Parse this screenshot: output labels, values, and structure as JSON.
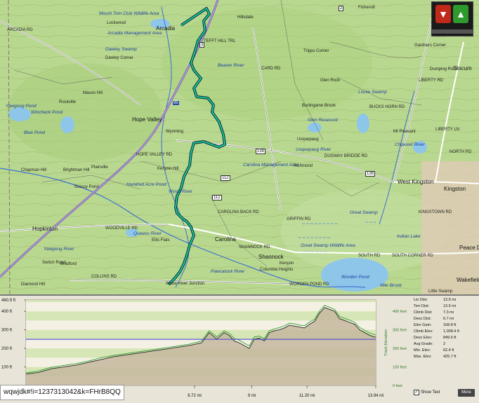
{
  "map": {
    "place_labels": [
      "Arcadia",
      "Hope Valley",
      "Rockville",
      "Hopkinton",
      "Carolina",
      "Shannock",
      "Kenyon",
      "Wood River Junction",
      "Ellis Flats",
      "Slocum",
      "West Kingston",
      "Kingston",
      "Usquepaug",
      "Richmond",
      "Tripps Corner",
      "Gardners Corner",
      "Dawley Corner",
      "Dumping Rock",
      "Burlingame Brook",
      "Columbia Heights",
      "Peace Dale",
      "Wakefield",
      "Switch Road",
      "Hillsdale",
      "Fishervill",
      "Mt Pleasant",
      "Glen Rock",
      "Diamond Hill",
      "Mason Hill",
      "Grassy Pond",
      "Wyoming",
      "Bradford",
      "Chapman Hill",
      "Brightman Hill",
      "Plainville",
      "Lockwood",
      "Kenyon Hill",
      "Little Swamp"
    ],
    "water_labels": [
      "Mount Tom Club Wildlife Area",
      "Arcadia Management Area",
      "Dawley Swamp",
      "Yawgoog Pond",
      "Wincheck Pond",
      "Blue Pond",
      "Locke Swamp",
      "Glen Reservoir",
      "Great Swamp",
      "Great Swamp Wildlife Area",
      "Worden Pond",
      "Wood River",
      "Beaver River",
      "Chipuxet River",
      "Queens River",
      "Hundred Acre Pond",
      "Yawgoog River",
      "Carolina Management Area",
      "Mile Brook",
      "Indian Lake",
      "Usquepaug River",
      "Pawcatuck River"
    ],
    "road_labels": [
      "TEFFT HILL TRL",
      "CARD RD",
      "LIBERTY RD",
      "LIBERTY LN",
      "WOODVILLE RD",
      "WORDEN POND RD",
      "COLLINS RD",
      "SOUTH CORNER RD",
      "KINGSTOWN RD",
      "NORTH RD",
      "DUGWAY BRIDGE RD",
      "HOPE VALLEY RD",
      "BUCKS HORN RD",
      "SHANNOCK RD",
      "ARCADIA RD",
      "GRIFFIN RD",
      "SOUTH RD",
      "CAROLINA BACK RD"
    ],
    "route_shields": [
      "3",
      "95",
      "112",
      "138",
      "138",
      "112",
      "2"
    ]
  },
  "vote": {
    "down_icon": "thumbs-down-icon",
    "up_icon": "thumbs-up-icon",
    "down_color": "#c02a1a",
    "up_color": "#2e9a2e"
  },
  "chart_data": {
    "type": "area",
    "x_axis": {
      "tick_labels": [
        "6.72 mi",
        "9 mi",
        "11.20 mi",
        "13.94 mi"
      ],
      "tick_values": [
        6.72,
        9.0,
        11.2,
        13.94
      ],
      "range": [
        0,
        13.94
      ]
    },
    "y_axis_left": {
      "tick_labels": [
        "460.9 ft",
        "400 ft",
        "300 ft",
        "200 ft",
        "100 ft"
      ],
      "tick_values": [
        460.9,
        400,
        300,
        200,
        100
      ],
      "range": [
        0,
        460.9
      ]
    },
    "y_axis_right": {
      "label": "Track Elevation",
      "tick_labels": [
        "400 feet",
        "300 feet",
        "200 feet",
        "100 feet",
        "0 feet"
      ],
      "tick_values": [
        400,
        300,
        200,
        100,
        0
      ],
      "range": [
        0,
        460.9
      ]
    },
    "reference_line": 249,
    "colors": {
      "terrain_fill": "#c6b79f",
      "terrain_line": "#222222",
      "track_line": "#2f9e2f",
      "reference": "#3c3cd6",
      "band_light": "#f4f1e4",
      "band_dark": "#d7e6b6"
    },
    "series": [
      {
        "x": [
          0,
          0.5,
          1.0,
          1.5,
          2.0,
          2.5,
          3.0,
          3.5,
          4.0,
          4.5,
          5.0,
          5.5,
          6.0,
          6.5,
          7.0,
          7.3,
          7.6,
          7.9,
          8.1,
          8.3,
          8.5,
          8.7,
          8.9,
          9.1,
          9.3,
          9.5,
          9.7,
          9.9,
          10.1,
          10.3,
          10.5,
          10.7,
          10.9,
          11.1,
          11.3,
          11.5,
          11.7,
          11.9,
          12.1,
          12.3,
          12.5,
          12.7,
          12.9,
          13.1,
          13.3,
          13.5,
          13.7,
          13.94
        ],
        "y": [
          62,
          70,
          90,
          100,
          110,
          125,
          140,
          155,
          165,
          175,
          185,
          195,
          205,
          215,
          230,
          285,
          250,
          285,
          270,
          240,
          230,
          215,
          200,
          250,
          255,
          240,
          285,
          295,
          300,
          310,
          325,
          320,
          315,
          310,
          330,
          345,
          390,
          420,
          410,
          400,
          360,
          350,
          340,
          330,
          300,
          285,
          270,
          260
        ]
      },
      {
        "x": [
          0,
          0.5,
          1.0,
          1.5,
          2.0,
          2.5,
          3.0,
          3.5,
          4.0,
          4.5,
          5.0,
          5.5,
          6.0,
          6.5,
          7.0,
          7.3,
          7.6,
          7.9,
          8.1,
          8.3,
          8.5,
          8.7,
          8.9,
          9.1,
          9.3,
          9.5,
          9.7,
          9.9,
          10.1,
          10.3,
          10.5,
          10.7,
          10.9,
          11.1,
          11.3,
          11.5,
          11.7,
          11.9,
          12.1,
          12.3,
          12.5,
          12.7,
          12.9,
          13.1,
          13.3,
          13.5,
          13.7,
          13.94
        ],
        "y": [
          68,
          78,
          98,
          108,
          118,
          132,
          150,
          162,
          172,
          182,
          192,
          202,
          212,
          222,
          240,
          295,
          262,
          295,
          282,
          254,
          244,
          228,
          214,
          262,
          266,
          252,
          296,
          305,
          312,
          322,
          336,
          332,
          326,
          322,
          342,
          356,
          402,
          432,
          422,
          410,
          372,
          362,
          352,
          340,
          312,
          298,
          282,
          272
        ]
      }
    ]
  },
  "stats": [
    {
      "label": "Lin Dist:",
      "value": "13.9 mi"
    },
    {
      "label": "Terr Dist:",
      "value": "13.9 mi"
    },
    {
      "label": "Climb Dist:",
      "value": "7.3 mi"
    },
    {
      "label": "Desc Dist:",
      "value": "6.7 mi"
    },
    {
      "label": "Elev Gain:",
      "value": "168.8 ft"
    },
    {
      "label": "Climb Elev:",
      "value": "1,008.4 ft"
    },
    {
      "label": "Desc Elev:",
      "value": "849.6 ft"
    },
    {
      "label": "Avg Grade:",
      "value": "2"
    },
    {
      "label": "Min. Elev:",
      "value": "62.4 ft"
    },
    {
      "label": "Max. Elev:",
      "value": "425.7 ft"
    }
  ],
  "controls": {
    "show_text_label": "Show Text",
    "show_text_checked": true,
    "more_label": "More"
  },
  "url_fragment": "wqwjdk#!i=1237313042&k=FHrB8QQ"
}
